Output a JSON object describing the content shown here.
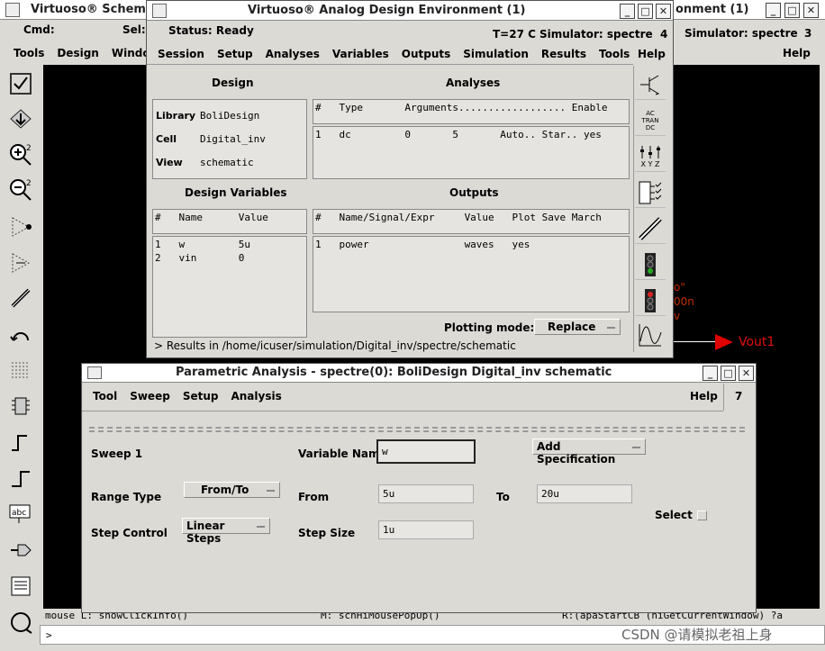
{
  "back_window": {
    "title": "Virtuoso® Schem",
    "cmd_label": "Cmd:",
    "sel_label": "Sel:",
    "menu": [
      "Tools",
      "Design",
      "Window"
    ],
    "status_right": "onment (1)",
    "sim_right": "Simulator: spectre",
    "sim_num": "3",
    "help": "Help",
    "mouse_l": "mouse L: showClickInfo()",
    "mouse_m": "M: schHiMousePopUp()",
    "mouse_r": "R:(apaStartCB (hiGetCurrentWindow) ?a",
    "prompt": ">",
    "net_label": "Vout1",
    "red_texts": [
      "o\"",
      "00n",
      "v"
    ]
  },
  "ade": {
    "title": "Virtuoso® Analog Design Environment (1)",
    "status": "Status: Ready",
    "temp": "T=27 C",
    "simulator": "Simulator: spectre",
    "num": "4",
    "menu": [
      "Session",
      "Setup",
      "Analyses",
      "Variables",
      "Outputs",
      "Simulation",
      "Results",
      "Tools"
    ],
    "help": "Help",
    "design_title": "Design",
    "analyses_title": "Analyses",
    "design": {
      "library_label": "Library",
      "library": "BoliDesign",
      "cell_label": "Cell",
      "cell": "Digital_inv",
      "view_label": "View",
      "view": "schematic"
    },
    "analyses_header": "#   Type       Arguments.................. Enable",
    "analyses_row": "1   dc         0       5       Auto.. Star.. yes",
    "design_vars_title": "Design Variables",
    "outputs_title": "Outputs",
    "vars_header": "#   Name      Value",
    "vars_rows": [
      "1   w         5u",
      "2   vin       0"
    ],
    "outputs_header": "#   Name/Signal/Expr     Value   Plot Save March",
    "outputs_row": "1   power                waves   yes",
    "plotting_mode_label": "Plotting mode:",
    "plotting_mode": "Replace",
    "results_path": "> Results in /home/icuser/simulation/Digital_inv/spectre/schematic",
    "right_tools": [
      "AC",
      "TRAN",
      "DC",
      "X Y Z"
    ]
  },
  "param": {
    "title": "Parametric Analysis - spectre(0): BoliDesign Digital_inv schematic",
    "menu": [
      "Tool",
      "Sweep",
      "Setup",
      "Analysis"
    ],
    "help": "Help",
    "num": "7",
    "sweep_label": "Sweep 1",
    "variable_name_label": "Variable Name",
    "variable_name": "w",
    "add_spec": "Add Specification",
    "range_type_label": "Range Type",
    "range_type": "From/To",
    "from_label": "From",
    "from": "5u",
    "to_label": "To",
    "to": "20u",
    "select_label": "Select",
    "step_control_label": "Step Control",
    "step_control": "Linear Steps",
    "step_size_label": "Step Size",
    "step_size": "1u"
  },
  "watermark": "CSDN @请模拟老祖上身"
}
